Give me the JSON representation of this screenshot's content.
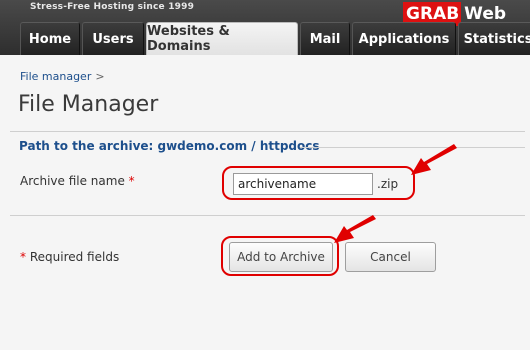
{
  "header": {
    "tagline": "Stress-Free Hosting since 1999",
    "logo_grab": "GRAB",
    "logo_web": "Web"
  },
  "tabs": [
    {
      "label": "Home",
      "active": false
    },
    {
      "label": "Users",
      "active": false
    },
    {
      "label": "Websites & Domains",
      "active": true
    },
    {
      "label": "Mail",
      "active": false
    },
    {
      "label": "Applications",
      "active": false
    },
    {
      "label": "Statistics",
      "active": false
    }
  ],
  "breadcrumb": {
    "item": "File manager",
    "separator": ">"
  },
  "page": {
    "title": "File Manager"
  },
  "section": {
    "legend": "Path to the archive: gwdemo.com / httpdocs"
  },
  "form": {
    "archive_label": "Archive file name",
    "required_marker": "*",
    "archive_value": "archivename",
    "extension": ".zip",
    "required_note": "Required fields"
  },
  "buttons": {
    "add": "Add to Archive",
    "cancel": "Cancel"
  },
  "colors": {
    "annotation": "#e00000",
    "link": "#1d4f8c",
    "header": "#2e2e2e"
  }
}
